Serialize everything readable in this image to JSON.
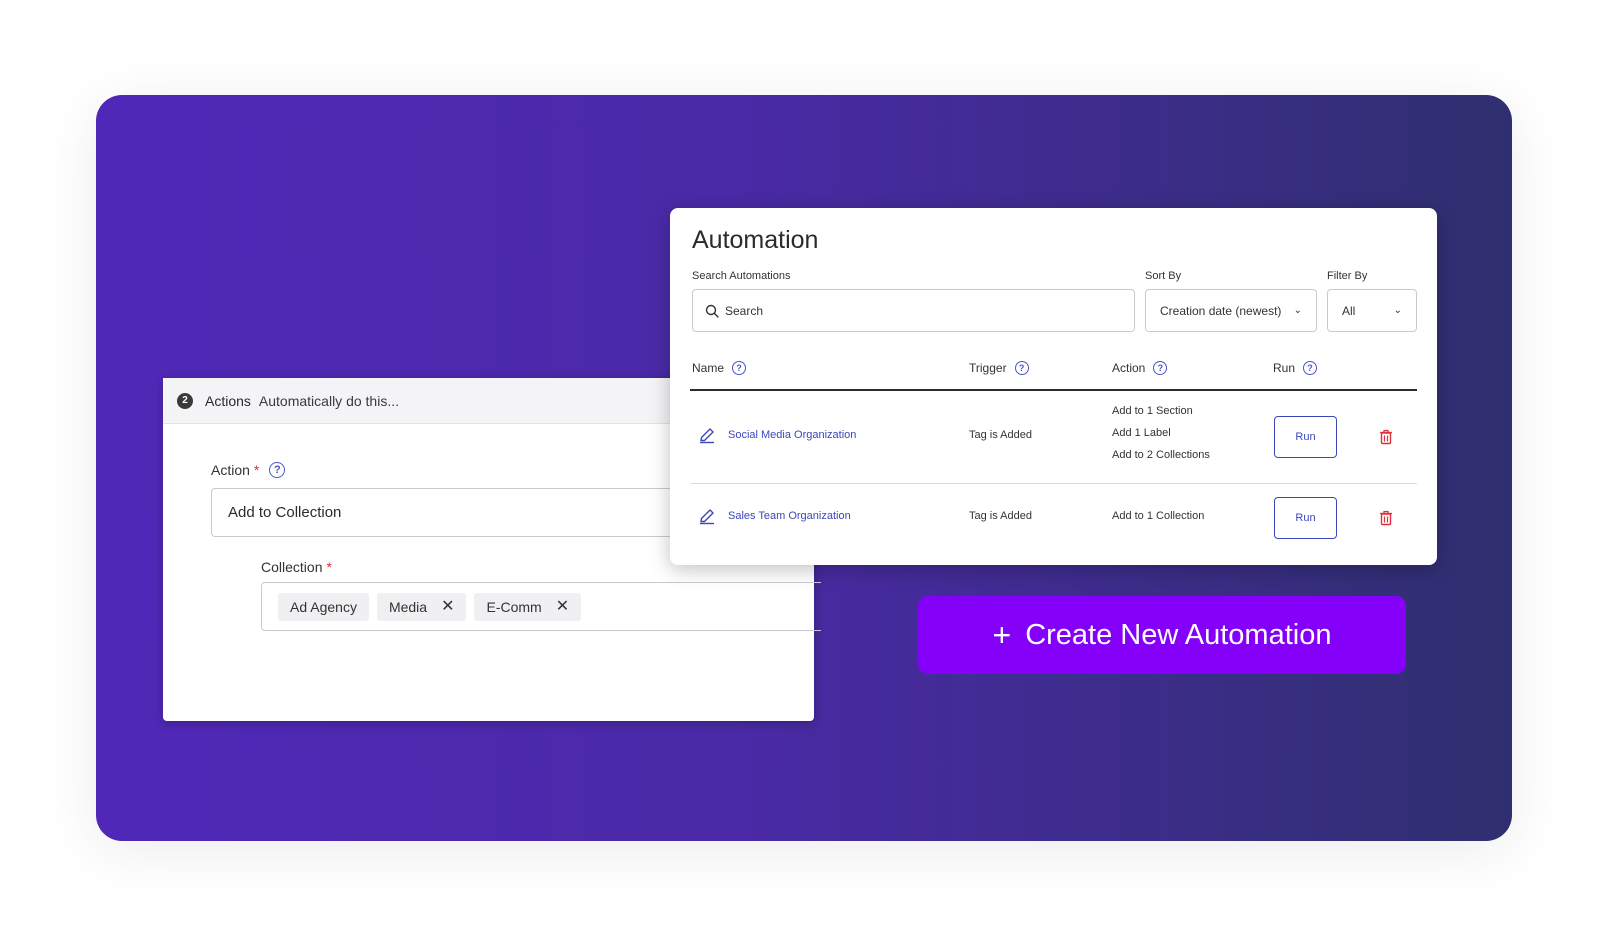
{
  "actions_panel": {
    "step_number": "2",
    "title": "Actions",
    "subtitle": "Automatically do this...",
    "action_label": "Action",
    "action_required": "*",
    "action_value": "Add to Collection",
    "collection_label": "Collection",
    "collection_required": "*",
    "chips": [
      {
        "label": "Ad Agency",
        "removable": false
      },
      {
        "label": "Media",
        "removable": true
      },
      {
        "label": "E-Comm",
        "removable": true
      }
    ]
  },
  "automation": {
    "title": "Automation",
    "search_label": "Search Automations",
    "search_placeholder": "Search",
    "sort_label": "Sort By",
    "sort_value": "Creation date (newest)",
    "filter_label": "Filter By",
    "filter_value": "All",
    "columns": [
      "Name",
      "Trigger",
      "Action",
      "Run"
    ],
    "rows": [
      {
        "name": "Social Media Organization",
        "trigger": "Tag is Added",
        "actions": [
          "Add to 1 Section",
          "Add 1 Label",
          "Add to 2 Collections"
        ],
        "run_label": "Run"
      },
      {
        "name": "Sales Team Organization",
        "trigger": "Tag is Added",
        "actions": [
          "Add to 1 Collection"
        ],
        "run_label": "Run"
      }
    ]
  },
  "create_button": {
    "icon": "+",
    "label": "Create New Automation"
  },
  "icons": {
    "help": "?",
    "remove": "✕",
    "chevron": "⌄"
  },
  "colors": {
    "accent_purple": "#8500f8",
    "link_blue": "#3b47b8",
    "delete_red": "#e0303a"
  }
}
